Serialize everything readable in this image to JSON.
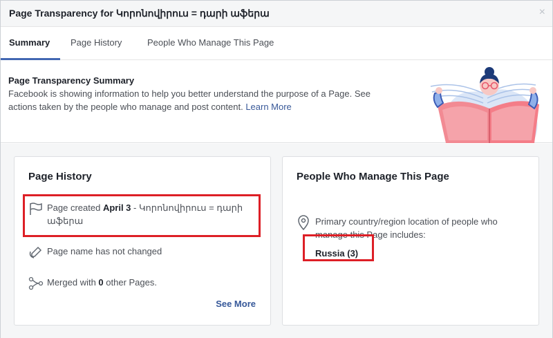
{
  "dialog": {
    "title": "Page Transparency for Կորոնովիրուս = դարի աֆերա",
    "close_label": "×"
  },
  "tabs": [
    {
      "label": "Summary",
      "active": true
    },
    {
      "label": "Page History",
      "active": false
    },
    {
      "label": "People Who Manage This Page",
      "active": false
    }
  ],
  "summary": {
    "heading": "Page Transparency Summary",
    "description_line1": "Facebook is showing information to help you better understand the purpose of a Page. See",
    "description_line2": "actions taken by the people who manage and post content.",
    "learn_more": "Learn More"
  },
  "history_card": {
    "title": "Page History",
    "created_prefix": "Page created ",
    "created_date": "April 3",
    "created_suffix_line1": " - Կորոնովիրուս = դարի",
    "created_suffix_line2": "աֆերա",
    "name_status": "Page name has not changed",
    "merged_prefix": "Merged with ",
    "merged_count": "0",
    "merged_suffix": " other Pages.",
    "see_more": "See More"
  },
  "people_card": {
    "title": "People Who Manage This Page",
    "location_text_line1": "Primary country/region location of people who",
    "location_text_line2": "manage this Page includes:",
    "country": "Russia (3)"
  },
  "colors": {
    "accent": "#4267b2",
    "link": "#385898",
    "highlight": "#dd1f26"
  }
}
